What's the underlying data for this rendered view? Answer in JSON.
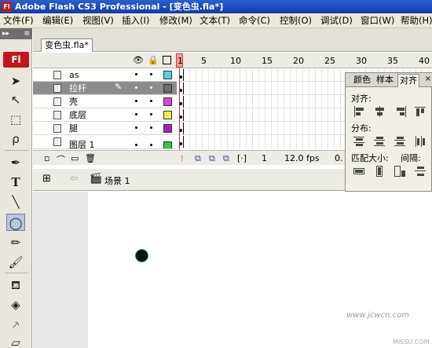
{
  "window": {
    "title": "Adobe Flash CS3 Professional - [变色虫.fla*]",
    "app_icon": "Fl"
  },
  "menu": [
    "文件(F)",
    "编辑(E)",
    "视图(V)",
    "插入(I)",
    "修改(M)",
    "文本(T)",
    "命令(C)",
    "控制(O)",
    "调试(D)",
    "窗口(W)",
    "帮助(H)"
  ],
  "toolbox": {
    "logo": "Fl"
  },
  "doc_tab": "变色虫.fla*",
  "timeline": {
    "frame_numbers": [
      "1",
      "5",
      "10",
      "15",
      "20",
      "25",
      "30",
      "35",
      "40"
    ],
    "layers": [
      {
        "name": "as",
        "color": "#4fd6e0"
      },
      {
        "name": "拉杆",
        "color": "#6e6e6e"
      },
      {
        "name": "壳",
        "color": "#e040e0"
      },
      {
        "name": "底层",
        "color": "#f0f040"
      },
      {
        "name": "腿",
        "color": "#a020c0"
      },
      {
        "name": "图层 1",
        "color": "#40c040"
      }
    ],
    "footer": {
      "current_frame": "1",
      "fps": "12.0 fps",
      "time": "0."
    }
  },
  "editbar": {
    "scene": "场景 1"
  },
  "align_panel": {
    "tabs": [
      "颜色",
      "样本",
      "对齐"
    ],
    "close": "×",
    "sections": {
      "align": "对齐:",
      "distribute": "分布:",
      "match_size": "匹配大小:",
      "spacing": "间隔:"
    }
  },
  "watermark": {
    "text": "www.jcwcn.com",
    "sub": "MISSU.COM"
  }
}
